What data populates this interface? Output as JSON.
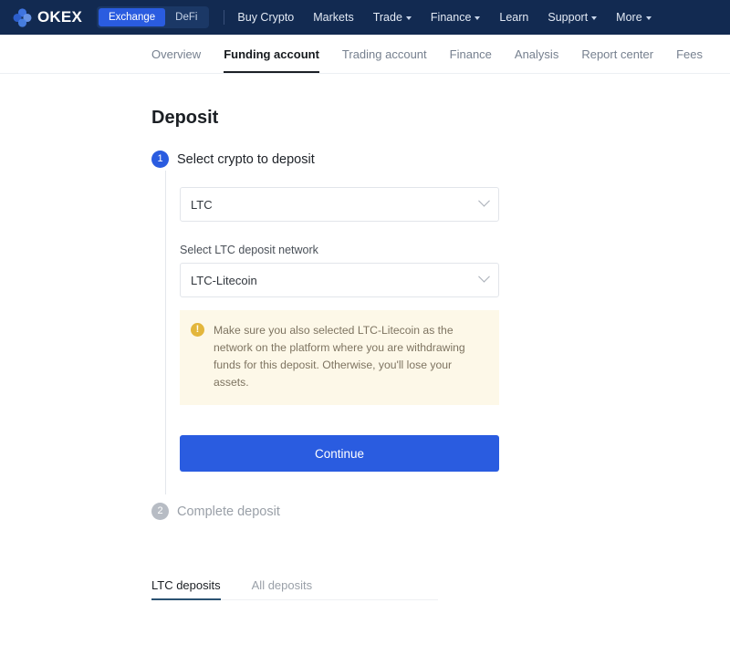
{
  "topnav": {
    "brand": "OKEX",
    "brand_logo_icon": "okex-diamond-logo-icon",
    "segments": [
      {
        "label": "Exchange",
        "active": true
      },
      {
        "label": "DeFi",
        "active": false
      }
    ],
    "links": [
      {
        "label": "Buy Crypto",
        "caret": false
      },
      {
        "label": "Markets",
        "caret": false
      },
      {
        "label": "Trade",
        "caret": true
      },
      {
        "label": "Finance",
        "caret": true
      },
      {
        "label": "Learn",
        "caret": false
      },
      {
        "label": "Support",
        "caret": true
      },
      {
        "label": "More",
        "caret": true
      }
    ]
  },
  "subnav": {
    "items": [
      {
        "label": "Overview",
        "active": false
      },
      {
        "label": "Funding account",
        "active": true
      },
      {
        "label": "Trading account",
        "active": false
      },
      {
        "label": "Finance",
        "active": false
      },
      {
        "label": "Analysis",
        "active": false
      },
      {
        "label": "Report center",
        "active": false
      },
      {
        "label": "Fees",
        "active": false
      }
    ]
  },
  "page": {
    "title": "Deposit"
  },
  "step1": {
    "number": "1",
    "title": "Select crypto to deposit",
    "crypto_select_value": "LTC",
    "network_label": "Select LTC deposit network",
    "network_select_value": "LTC-Litecoin",
    "warning_icon": "warning-exclamation-icon",
    "warning_text": "Make sure you also selected LTC-Litecoin as the network on the platform where you are withdrawing funds for this deposit. Otherwise, you'll lose your assets.",
    "continue_label": "Continue"
  },
  "step2": {
    "number": "2",
    "title": "Complete deposit"
  },
  "bottom_tabs": {
    "items": [
      {
        "label": "LTC deposits",
        "active": true
      },
      {
        "label": "All deposits",
        "active": false
      }
    ]
  },
  "colors": {
    "navbar_bg": "#122a51",
    "accent_blue": "#2a5ce0",
    "warning_bg": "#fdf8e8",
    "warning_icon": "#e3b63c",
    "active_tab_underline": "#2b5272"
  }
}
